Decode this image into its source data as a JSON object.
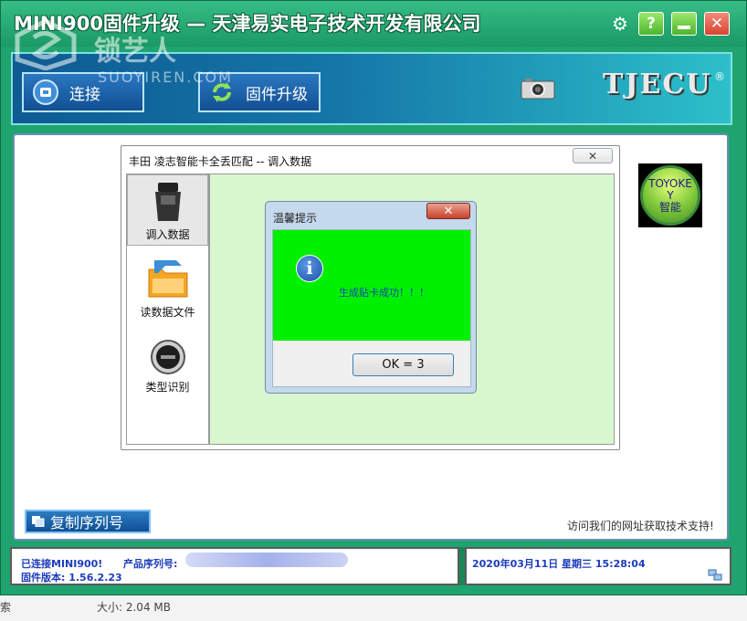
{
  "window": {
    "title": "MINI900固件升级 — 天津易实电子技术开发有限公司",
    "gear_glyph": "⚙",
    "help_glyph": "?",
    "close_glyph": "✕"
  },
  "watermark": {
    "text_cn": "锁艺人",
    "text_en": "SUOYIREN.COM"
  },
  "toolbar": {
    "connect_label": "连接",
    "firmware_label": "固件升级",
    "brand": "TJECU",
    "brand_reg": "®"
  },
  "dialog": {
    "title": "丰田 凌志智能卡全丢匹配 -- 调入数据",
    "close_glyph": "✕",
    "nav_items": [
      {
        "label": "调入数据",
        "icon": "obd-connector-icon"
      },
      {
        "label": "读数据文件",
        "icon": "folder-icon"
      },
      {
        "label": "类型识别",
        "icon": "start-button-icon"
      }
    ]
  },
  "badge": {
    "line1": "TOYOKE",
    "line2": "Y",
    "line3": "智能"
  },
  "messagebox": {
    "title": "温馨提示",
    "close_glyph": "✕",
    "info_glyph": "i",
    "message": "生成贴卡成功！！！",
    "ok_label": "OK = 3"
  },
  "copy_serial_label": "复制序列号",
  "support_text": "访问我们的网址获取技术支持!",
  "status": {
    "connected": "已连接MINI900!",
    "serial_label": "产品序列号:",
    "firmware_version": "固件版本:  1.56.2.23",
    "datetime": "2020年03月11日   星期三    15:28:04"
  },
  "footer": {
    "left": "索",
    "size": "大小: 2.04 MB"
  },
  "colors": {
    "window_green": "#1fa36f",
    "toolbar_blue": "#0d5b92",
    "message_green": "#00f000",
    "content_green": "#d9f7cf",
    "status_text": "#1d3dbd"
  }
}
